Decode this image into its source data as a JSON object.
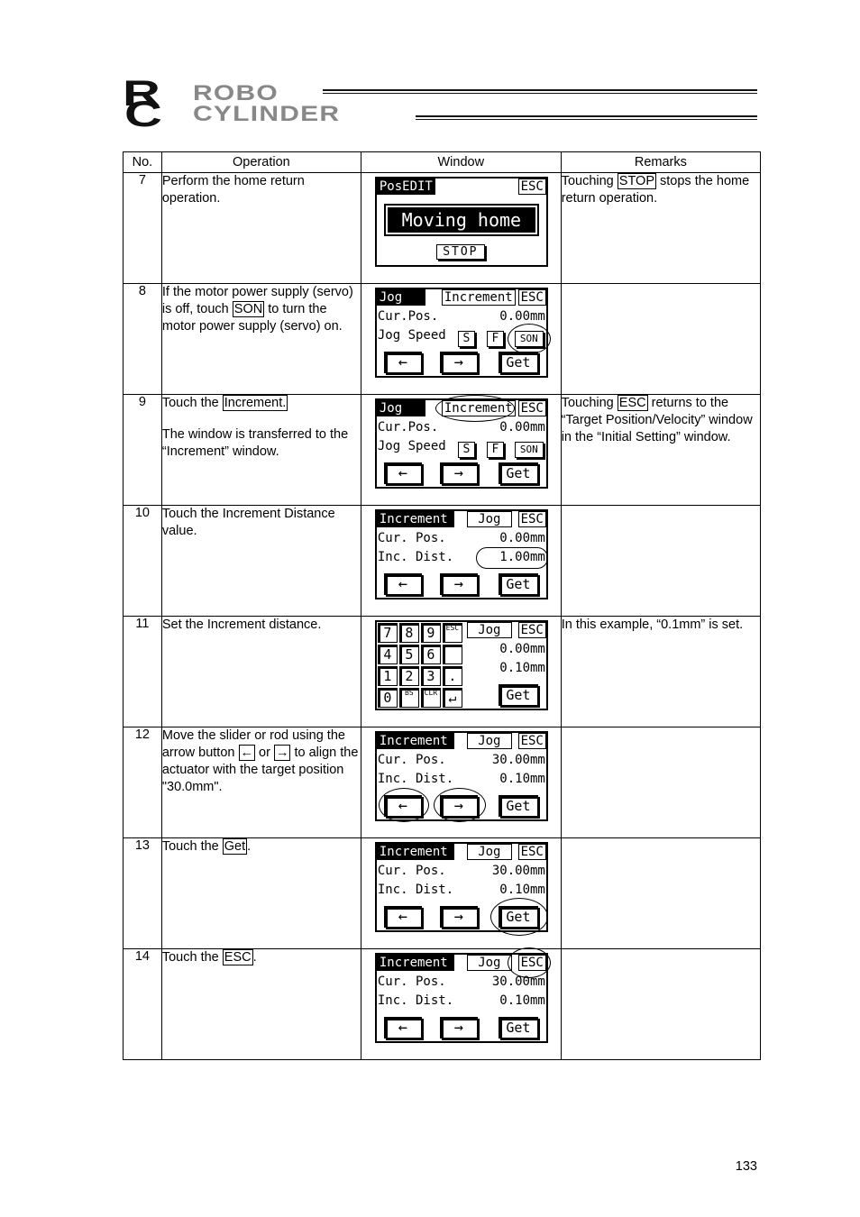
{
  "header": {
    "logo_mark": [
      "R",
      "C"
    ],
    "logo_line1": "ROBO",
    "logo_line2": "CYLINDER"
  },
  "table": {
    "columns": [
      "No.",
      "Operation",
      "Window",
      "Remarks"
    ],
    "rows": [
      {
        "no": "7",
        "operation": [
          "Perform the home return operation."
        ],
        "remarks": {
          "pre": "Touching ",
          "boxed": "STOP",
          "post": " stops the home return operation."
        },
        "window": {
          "title": "PosEDIT",
          "esc": "ESC",
          "message": "Moving home",
          "stop": "STOP"
        }
      },
      {
        "no": "8",
        "operation": {
          "pre": "If the motor power supply (servo) is off, touch ",
          "boxed": "SON",
          "post": " to turn the motor power supply (servo) on."
        },
        "remarks": "",
        "window": {
          "title": "Jog",
          "tab": "Increment",
          "esc": "ESC",
          "line1_label": "Cur.Pos.",
          "line1_value": "0.00mm",
          "line2_label": "Jog Speed",
          "speed_s": "S",
          "speed_f": "F",
          "son": "SON",
          "left": "←",
          "right": "→",
          "get": "Get",
          "highlight": "SON"
        }
      },
      {
        "no": "9",
        "operation": {
          "pre": "Touch the ",
          "boxed": "Increment.",
          "post": "",
          "second": "The window is transferred to the “Increment” window."
        },
        "remarks": {
          "pre": "Touching ",
          "boxed": "ESC",
          "post": " returns to the “Target Position/Velocity” window in the “Initial Setting” window."
        },
        "window": {
          "title": "Jog",
          "tab": "Increment",
          "esc": "ESC",
          "line1_label": "Cur.Pos.",
          "line1_value": "0.00mm",
          "line2_label": "Jog Speed",
          "speed_s": "S",
          "speed_f": "F",
          "son": "SON",
          "left": "←",
          "right": "→",
          "get": "Get",
          "highlight": "Increment"
        }
      },
      {
        "no": "10",
        "operation": [
          "Touch the Increment Distance value."
        ],
        "remarks": "",
        "window": {
          "title": "Increment",
          "tab": "Jog",
          "esc": "ESC",
          "line1_label": "Cur. Pos.",
          "line1_value": "0.00mm",
          "line2_label": "Inc. Dist.",
          "line2_value": "1.00mm",
          "left": "←",
          "right": "→",
          "get": "Get",
          "highlight": "Inc. Dist. value"
        }
      },
      {
        "no": "11",
        "operation": [
          "Set the Increment distance."
        ],
        "remarks": {
          "pre": "In this example, “0.1mm” is set.",
          "boxed": "",
          "post": ""
        },
        "window": {
          "keypad": [
            "7",
            "8",
            "9",
            "ESC",
            "4",
            "5",
            "6",
            "",
            "1",
            "2",
            "3",
            ".",
            "0",
            "BS",
            "CLR",
            "↵"
          ],
          "tab": "Jog",
          "esc": "ESC",
          "line1_value": "0.00mm",
          "line2_value": "0.10mm",
          "get": "Get"
        }
      },
      {
        "no": "12",
        "operation": {
          "pre": "Move the slider or rod using the arrow button ",
          "boxed": "←",
          "mid": " or ",
          "boxed2": "→",
          "post": " to align the actuator with the target position \"30.0mm\"."
        },
        "remarks": "",
        "window": {
          "title": "Increment",
          "tab": "Jog",
          "esc": "ESC",
          "line1_label": "Cur. Pos.",
          "line1_value": "30.00mm",
          "line2_label": "Inc. Dist.",
          "line2_value": "0.10mm",
          "left": "←",
          "right": "→",
          "get": "Get",
          "highlight": "arrows"
        }
      },
      {
        "no": "13",
        "operation": {
          "pre": "Touch the ",
          "boxed": "Get",
          "post": "."
        },
        "remarks": "",
        "window": {
          "title": "Increment",
          "tab": "Jog",
          "esc": "ESC",
          "line1_label": "Cur. Pos.",
          "line1_value": "30.00mm",
          "line2_label": "Inc. Dist.",
          "line2_value": "0.10mm",
          "left": "←",
          "right": "→",
          "get": "Get",
          "highlight": "Get"
        }
      },
      {
        "no": "14",
        "operation": {
          "pre": "Touch the ",
          "boxed": "ESC",
          "post": "."
        },
        "remarks": "",
        "window": {
          "title": "Increment",
          "tab": "Jog",
          "esc": "ESC",
          "line1_label": "Cur. Pos.",
          "line1_value": "30.00mm",
          "line2_label": "Inc. Dist.",
          "line2_value": "0.10mm",
          "left": "←",
          "right": "→",
          "get": "Get",
          "highlight": "ESC"
        }
      }
    ]
  },
  "page_number": "133"
}
